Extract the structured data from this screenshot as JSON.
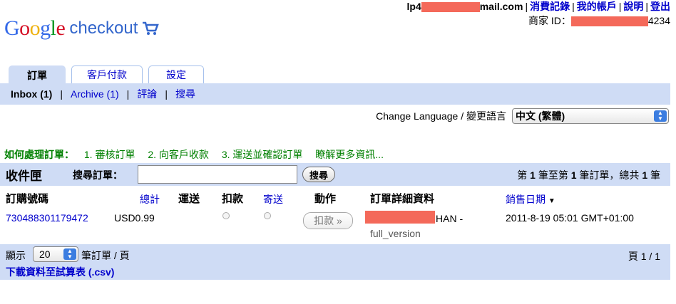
{
  "header": {
    "logo_word": "Google",
    "logo_sub": "checkout",
    "email_prefix": "lp4",
    "email_suffix": "mail.com",
    "links": [
      "消費記錄",
      "我的帳戶",
      "說明",
      "登出"
    ],
    "merchant_label": "商家 ID：",
    "merchant_suffix": "4234"
  },
  "tabs": [
    {
      "label": "訂單",
      "active": true
    },
    {
      "label": "客戶付款",
      "active": false
    },
    {
      "label": "設定",
      "active": false
    }
  ],
  "subnav": {
    "inbox": "Inbox (1)",
    "archive": "Archive (1)",
    "comments": "評論",
    "search": "搜尋"
  },
  "language": {
    "label": "Change Language / 變更語言",
    "selected": "中文 (繁體)"
  },
  "howto": {
    "lead": "如何處理訂單：",
    "steps": [
      "1. 審核訂單",
      "2. 向客戶收款",
      "3. 運送並確認訂單",
      "瞭解更多資訊..."
    ]
  },
  "inbox": {
    "title": "收件匣",
    "search_label": "搜尋訂單：",
    "search_value": "",
    "search_button": "搜尋",
    "range_prefix": "第 ",
    "range_a": "1",
    "range_mid": " 筆至第 ",
    "range_b": "1",
    "range_mid2": " 筆訂單，總共 ",
    "range_total": "1",
    "range_suffix": " 筆"
  },
  "table": {
    "headers": {
      "order_no": "訂購號碼",
      "total": "總計",
      "shipping": "運送",
      "charge": "扣款",
      "ship": "寄送",
      "action": "動作",
      "details": "訂單詳細資料",
      "date": "銷售日期"
    },
    "sort_icon": "▼",
    "rows": [
      {
        "order_no": "730488301179472",
        "total": "USD0.99",
        "action": "扣款 »",
        "details_suffix": "HAN -",
        "details_line2": "full_version",
        "date": "2011-8-19 05:01 GMT+01:00"
      }
    ]
  },
  "footer": {
    "show_label": "顯示",
    "per_page": "20",
    "per_page_after": "筆訂單 / 頁",
    "page_indicator": "頁 1 / 1",
    "download": "下載資料至試算表 (.csv)"
  },
  "colors": {
    "band": "#cfdcf5",
    "link": "#0000cc",
    "green": "#008000",
    "redaction": "#f4695a"
  }
}
